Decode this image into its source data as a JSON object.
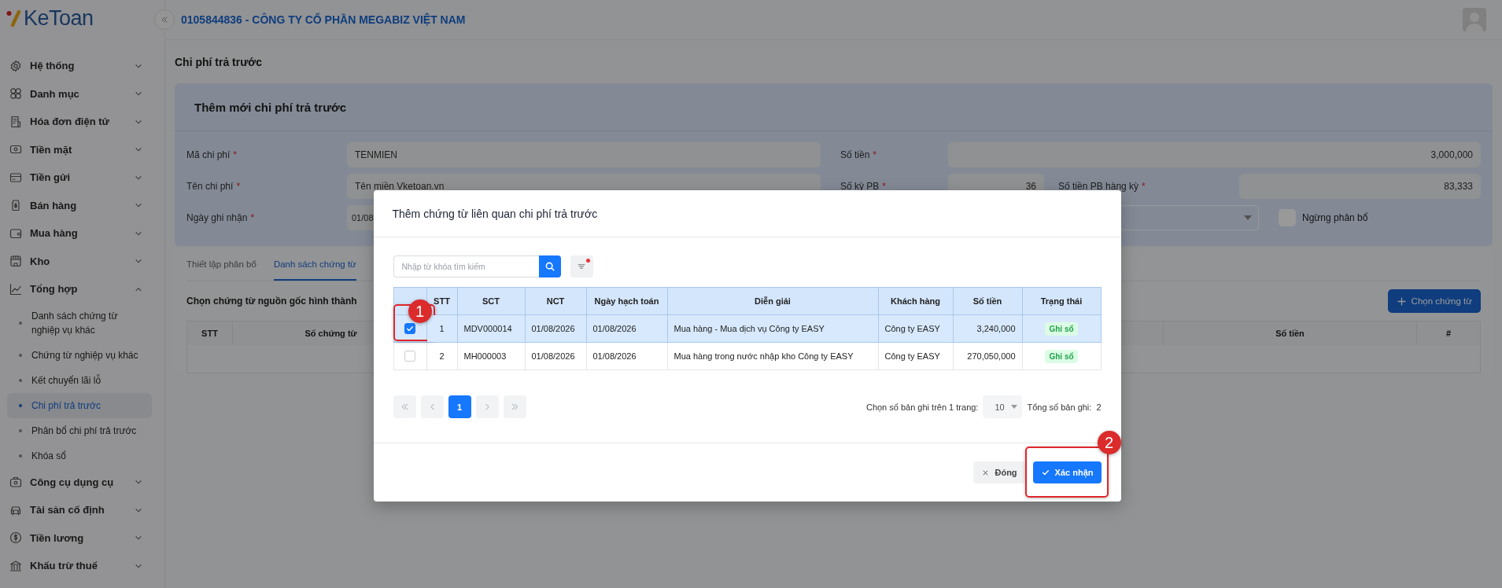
{
  "app": {
    "logo": "KeToan"
  },
  "header": {
    "company": "0105844836 - CÔNG TY CỔ PHẦN MEGABIZ VIỆT NAM"
  },
  "sidebar": {
    "items": [
      {
        "label": "Hệ thống",
        "expanded": false
      },
      {
        "label": "Danh mục",
        "expanded": false
      },
      {
        "label": "Hóa đơn điện tử",
        "expanded": false
      },
      {
        "label": "Tiền mặt",
        "expanded": false
      },
      {
        "label": "Tiền gửi",
        "expanded": false
      },
      {
        "label": "Bán hàng",
        "expanded": false
      },
      {
        "label": "Mua hàng",
        "expanded": false
      },
      {
        "label": "Kho",
        "expanded": false
      },
      {
        "label": "Tổng hợp",
        "expanded": true,
        "children": [
          {
            "label": "Danh sách chứng từ nghiệp vụ khác",
            "selected": false
          },
          {
            "label": "Chứng từ nghiệp vụ khác",
            "selected": false
          },
          {
            "label": "Kết chuyển lãi lỗ",
            "selected": false
          },
          {
            "label": "Chi phí trả trước",
            "selected": true
          },
          {
            "label": "Phân bổ chi phí trả trước",
            "selected": false
          },
          {
            "label": "Khóa sổ",
            "selected": false
          }
        ]
      },
      {
        "label": "Công cụ dụng cụ",
        "expanded": false
      },
      {
        "label": "Tài sản cố định",
        "expanded": false
      },
      {
        "label": "Tiền lương",
        "expanded": false
      },
      {
        "label": "Khấu trừ thuế",
        "expanded": false
      }
    ]
  },
  "page_title": "Chi phí trả trước",
  "form": {
    "title": "Thêm mới chi phí trả trước",
    "code": {
      "label": "Mã chi phí",
      "mark": "*",
      "value": "TENMIEN"
    },
    "amount": {
      "label": "Số tiền",
      "mark": "*",
      "value": "3,000,000"
    },
    "name": {
      "label": "Tên chi phí",
      "mark": "*",
      "value": "Tên miền Vketoan.vn"
    },
    "periods": {
      "label": "Số kỳ PB",
      "mark": "*",
      "value": "36"
    },
    "period_amount": {
      "label": "Số tiền PB hàng kỳ",
      "mark": "*",
      "value": "83,333"
    },
    "date": {
      "label": "Ngày ghi nhận",
      "mark": "*",
      "value": "01/08"
    },
    "stop_allocation": {
      "label": "Ngừng phân bổ",
      "checked": false
    }
  },
  "tabs": [
    {
      "label": "Thiết lập phân bổ",
      "selected": false
    },
    {
      "label": "Danh sách chứng từ",
      "selected": true
    }
  ],
  "source_docs": {
    "title": "Chọn chứng từ nguồn gốc hình thành",
    "button": "Chọn chứng từ",
    "columns": [
      "STT",
      "Số chứng từ",
      "Số tiền",
      "#"
    ]
  },
  "dialog": {
    "title": "Thêm chứng từ liên quan chi phí trả trước",
    "search": {
      "placeholder": "Nhập từ khóa tìm kiếm"
    },
    "filter_active": true,
    "columns": [
      "STT",
      "SCT",
      "NCT",
      "Ngày hạch toán",
      "Diễn giải",
      "Khách hàng",
      "Số tiền",
      "Trạng thái"
    ],
    "rows": [
      {
        "checked": true,
        "callout": "1",
        "cells": [
          "1",
          "MDV000014",
          "01/08/2026",
          "01/08/2026",
          "Mua hàng - Mua dịch vụ Công ty EASY",
          "Công ty EASY",
          "3,240,000"
        ],
        "status": "Ghi sổ"
      },
      {
        "checked": false,
        "cells": [
          "2",
          "MH000003",
          "01/08/2026",
          "01/08/2026",
          "Mua hàng trong nước nhập kho Công ty EASY",
          "Công ty EASY",
          "270,050,000"
        ],
        "status": "Ghi sổ"
      }
    ],
    "pages": [
      {
        "label": "1",
        "selected": true
      }
    ],
    "page_size_label": "Chọn số bản ghi trên 1 trang:",
    "page_size": "10",
    "total_label": "Tổng số bản ghi:",
    "total": "2",
    "buttons": [
      {
        "label": "Đóng",
        "kind": "secondary"
      },
      {
        "label": "Xác nhận",
        "kind": "primary",
        "callout": "2"
      }
    ]
  }
}
